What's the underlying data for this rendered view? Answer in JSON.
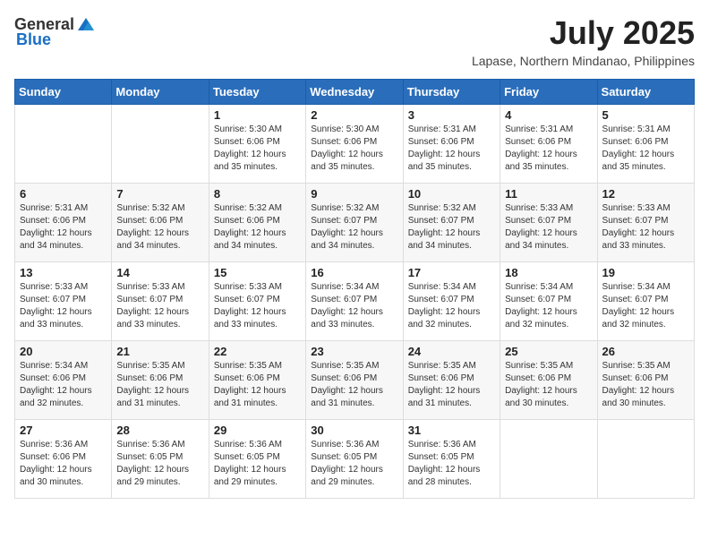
{
  "header": {
    "logo_general": "General",
    "logo_blue": "Blue",
    "title": "July 2025",
    "subtitle": "Lapase, Northern Mindanao, Philippines"
  },
  "days_of_week": [
    "Sunday",
    "Monday",
    "Tuesday",
    "Wednesday",
    "Thursday",
    "Friday",
    "Saturday"
  ],
  "weeks": [
    [
      {
        "day": "",
        "info": ""
      },
      {
        "day": "",
        "info": ""
      },
      {
        "day": "1",
        "info": "Sunrise: 5:30 AM\nSunset: 6:06 PM\nDaylight: 12 hours and 35 minutes."
      },
      {
        "day": "2",
        "info": "Sunrise: 5:30 AM\nSunset: 6:06 PM\nDaylight: 12 hours and 35 minutes."
      },
      {
        "day": "3",
        "info": "Sunrise: 5:31 AM\nSunset: 6:06 PM\nDaylight: 12 hours and 35 minutes."
      },
      {
        "day": "4",
        "info": "Sunrise: 5:31 AM\nSunset: 6:06 PM\nDaylight: 12 hours and 35 minutes."
      },
      {
        "day": "5",
        "info": "Sunrise: 5:31 AM\nSunset: 6:06 PM\nDaylight: 12 hours and 35 minutes."
      }
    ],
    [
      {
        "day": "6",
        "info": "Sunrise: 5:31 AM\nSunset: 6:06 PM\nDaylight: 12 hours and 34 minutes."
      },
      {
        "day": "7",
        "info": "Sunrise: 5:32 AM\nSunset: 6:06 PM\nDaylight: 12 hours and 34 minutes."
      },
      {
        "day": "8",
        "info": "Sunrise: 5:32 AM\nSunset: 6:06 PM\nDaylight: 12 hours and 34 minutes."
      },
      {
        "day": "9",
        "info": "Sunrise: 5:32 AM\nSunset: 6:07 PM\nDaylight: 12 hours and 34 minutes."
      },
      {
        "day": "10",
        "info": "Sunrise: 5:32 AM\nSunset: 6:07 PM\nDaylight: 12 hours and 34 minutes."
      },
      {
        "day": "11",
        "info": "Sunrise: 5:33 AM\nSunset: 6:07 PM\nDaylight: 12 hours and 34 minutes."
      },
      {
        "day": "12",
        "info": "Sunrise: 5:33 AM\nSunset: 6:07 PM\nDaylight: 12 hours and 33 minutes."
      }
    ],
    [
      {
        "day": "13",
        "info": "Sunrise: 5:33 AM\nSunset: 6:07 PM\nDaylight: 12 hours and 33 minutes."
      },
      {
        "day": "14",
        "info": "Sunrise: 5:33 AM\nSunset: 6:07 PM\nDaylight: 12 hours and 33 minutes."
      },
      {
        "day": "15",
        "info": "Sunrise: 5:33 AM\nSunset: 6:07 PM\nDaylight: 12 hours and 33 minutes."
      },
      {
        "day": "16",
        "info": "Sunrise: 5:34 AM\nSunset: 6:07 PM\nDaylight: 12 hours and 33 minutes."
      },
      {
        "day": "17",
        "info": "Sunrise: 5:34 AM\nSunset: 6:07 PM\nDaylight: 12 hours and 32 minutes."
      },
      {
        "day": "18",
        "info": "Sunrise: 5:34 AM\nSunset: 6:07 PM\nDaylight: 12 hours and 32 minutes."
      },
      {
        "day": "19",
        "info": "Sunrise: 5:34 AM\nSunset: 6:07 PM\nDaylight: 12 hours and 32 minutes."
      }
    ],
    [
      {
        "day": "20",
        "info": "Sunrise: 5:34 AM\nSunset: 6:06 PM\nDaylight: 12 hours and 32 minutes."
      },
      {
        "day": "21",
        "info": "Sunrise: 5:35 AM\nSunset: 6:06 PM\nDaylight: 12 hours and 31 minutes."
      },
      {
        "day": "22",
        "info": "Sunrise: 5:35 AM\nSunset: 6:06 PM\nDaylight: 12 hours and 31 minutes."
      },
      {
        "day": "23",
        "info": "Sunrise: 5:35 AM\nSunset: 6:06 PM\nDaylight: 12 hours and 31 minutes."
      },
      {
        "day": "24",
        "info": "Sunrise: 5:35 AM\nSunset: 6:06 PM\nDaylight: 12 hours and 31 minutes."
      },
      {
        "day": "25",
        "info": "Sunrise: 5:35 AM\nSunset: 6:06 PM\nDaylight: 12 hours and 30 minutes."
      },
      {
        "day": "26",
        "info": "Sunrise: 5:35 AM\nSunset: 6:06 PM\nDaylight: 12 hours and 30 minutes."
      }
    ],
    [
      {
        "day": "27",
        "info": "Sunrise: 5:36 AM\nSunset: 6:06 PM\nDaylight: 12 hours and 30 minutes."
      },
      {
        "day": "28",
        "info": "Sunrise: 5:36 AM\nSunset: 6:05 PM\nDaylight: 12 hours and 29 minutes."
      },
      {
        "day": "29",
        "info": "Sunrise: 5:36 AM\nSunset: 6:05 PM\nDaylight: 12 hours and 29 minutes."
      },
      {
        "day": "30",
        "info": "Sunrise: 5:36 AM\nSunset: 6:05 PM\nDaylight: 12 hours and 29 minutes."
      },
      {
        "day": "31",
        "info": "Sunrise: 5:36 AM\nSunset: 6:05 PM\nDaylight: 12 hours and 28 minutes."
      },
      {
        "day": "",
        "info": ""
      },
      {
        "day": "",
        "info": ""
      }
    ]
  ]
}
